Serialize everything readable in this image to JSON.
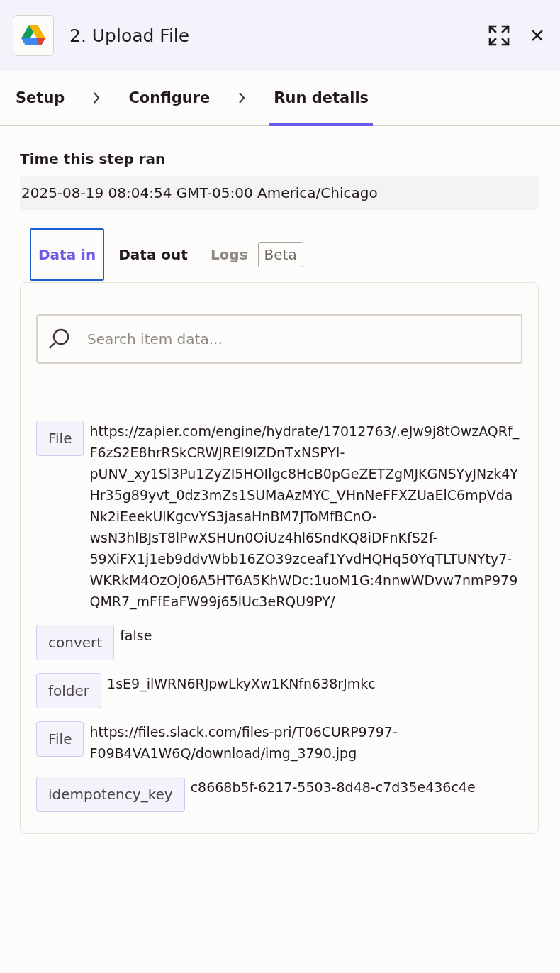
{
  "header": {
    "title": "2. Upload File"
  },
  "steps": [
    {
      "label": "Setup",
      "selected": false
    },
    {
      "label": "Configure",
      "selected": false
    },
    {
      "label": "Run details",
      "selected": true
    }
  ],
  "run_time": {
    "label": "Time this step ran",
    "value": "2025-08-19 08:04:54 GMT-05:00 America/Chicago"
  },
  "data_tabs": [
    {
      "label": "Data in",
      "selected": true,
      "disabled": false
    },
    {
      "label": "Data out",
      "selected": false,
      "disabled": false
    },
    {
      "label": "Logs",
      "selected": false,
      "disabled": true,
      "badge": "Beta"
    }
  ],
  "search": {
    "placeholder": "Search item data..."
  },
  "fields": [
    {
      "key": "File",
      "value": "https://zapier.com/engine/hydrate/17012763/.eJw9j8tOwzAQRf_F6zS2E8hrRSkCRWJREI9IZDnTxNSPYI-pUNV_xy1Sl3Pu1ZyZI5HOIlgc8HcB0pGeZETZgMJKGNSYyJNzk4YHr35g89yvt_0dz3mZs1SUMaAzMYC_VHnNeFFXZUaElC6mpVdaNk2iEeekUlKgcvYS3jasaHnBM7JToMfBCnO-wsN3hlBJsT8lPwXSHUn0OiUz4hl6SndKQ8iDFnKfS2f-59XiFX1j1eb9ddvWbb16ZO39zceaf1YvdHQHq50YqTLTUNYty7-WKRkM4OzOj06A5HT6A5KhWDc:1uoM1G:4nnwWDvw7nmP979QMR7_mFfEaFW99j65lUc3eRQU9PY/"
    },
    {
      "key": "convert",
      "value": "false"
    },
    {
      "key": "folder",
      "value": "1sE9_ilWRN6RJpwLkyXw1KNfn638rJmkc"
    },
    {
      "key": "File",
      "value": "https://files.slack.com/files-pri/T06CURP9797-F09B4VA1W6Q/download/img_3790.jpg"
    },
    {
      "key": "idempotency_key",
      "value": "c8668b5f-6217-5503-8d48-c7d35e436c4e"
    }
  ]
}
